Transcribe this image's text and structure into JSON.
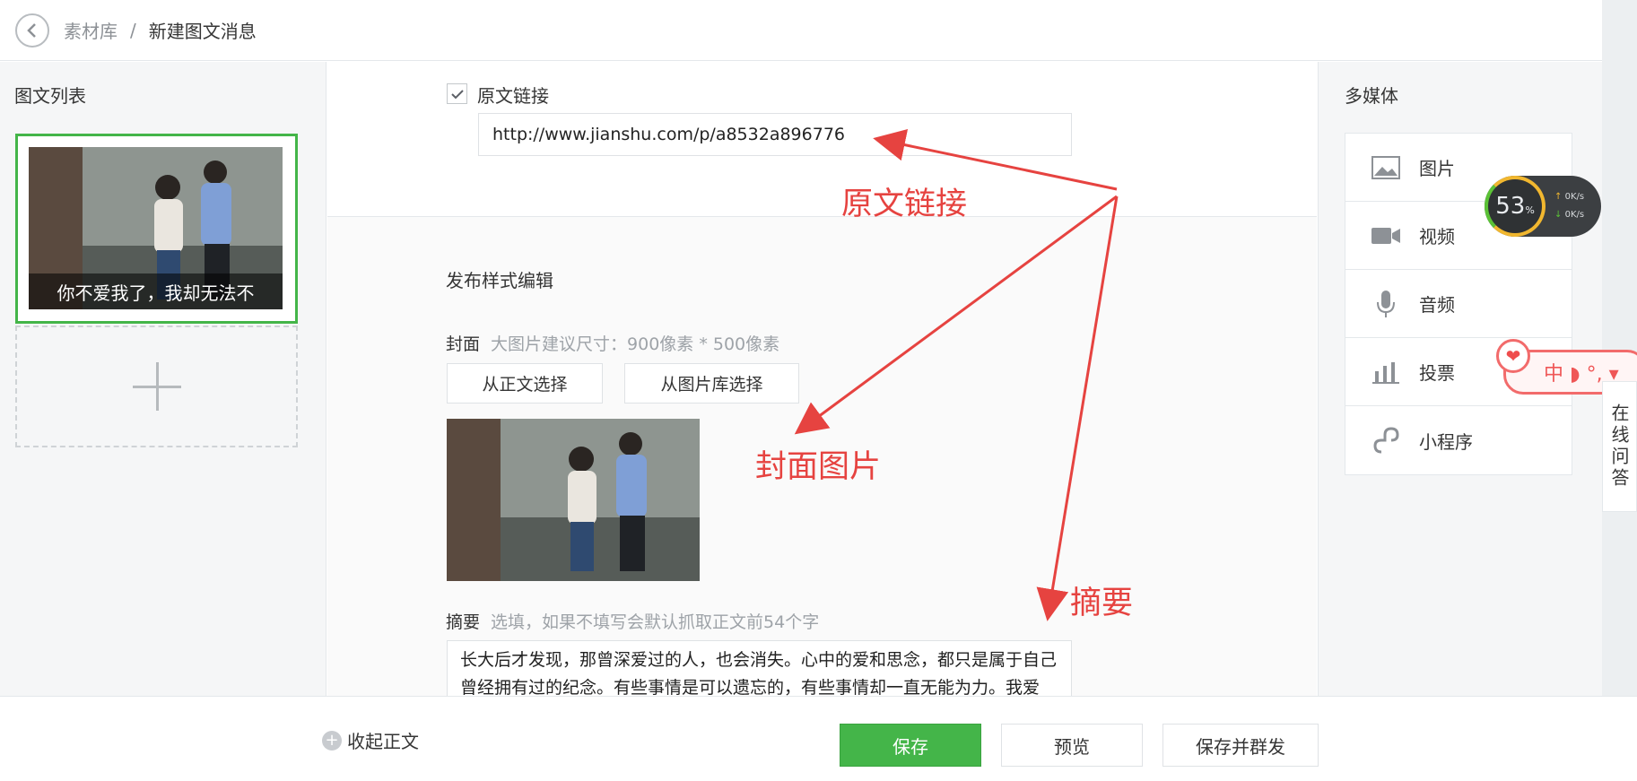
{
  "header": {
    "back_icon": "chevron-left-icon",
    "breadcrumb_parent": "素材库",
    "breadcrumb_sep": "/",
    "breadcrumb_current": "新建图文消息"
  },
  "left_panel": {
    "title": "图文列表",
    "articles": [
      {
        "caption": "你不爱我了，我却无法不"
      }
    ],
    "add_icon": "plus-icon"
  },
  "center": {
    "original_link": {
      "checked": true,
      "label": "原文链接",
      "url": "http://www.jianshu.com/p/a8532a896776"
    },
    "publish_section_title": "发布样式编辑",
    "cover": {
      "label": "封面",
      "hint": "大图片建议尺寸：900像素 * 500像素",
      "btn_from_body": "从正文选择",
      "btn_from_library": "从图片库选择"
    },
    "summary": {
      "label": "摘要",
      "hint": "选填，如果不填写会默认抓取正文前54个字",
      "text": "长大后才发现，那曾深爱过的人，也会消失。心中的爱和思念，都只是属于自己曾经拥有过的纪念。有些事情是可以遗忘的，有些事情却一直无能为力。我爱你，这是我的劫"
    },
    "annotations": {
      "original_link": "原文链接",
      "cover_image": "封面图片",
      "summary": "摘要"
    }
  },
  "right_panel": {
    "title": "多媒体",
    "items": [
      {
        "label": "图片",
        "icon": "image-icon"
      },
      {
        "label": "视频",
        "icon": "video-icon"
      },
      {
        "label": "音频",
        "icon": "microphone-icon"
      },
      {
        "label": "投票",
        "icon": "bar-chart-icon"
      },
      {
        "label": "小程序",
        "icon": "link-icon"
      }
    ]
  },
  "overlays": {
    "speed_widget": {
      "percent": "53",
      "percent_unit": "%",
      "up": "0K/s",
      "down": "0K/s"
    },
    "ime_toolbar": {
      "text": "中 ◗ °, ▾"
    },
    "qa_tab": "在线问答"
  },
  "footer": {
    "collapse_label": "收起正文",
    "save": "保存",
    "preview": "预览",
    "save_and_send": "保存并群发"
  },
  "colors": {
    "primary_green": "#44b549",
    "annotation_red": "#e64340"
  }
}
